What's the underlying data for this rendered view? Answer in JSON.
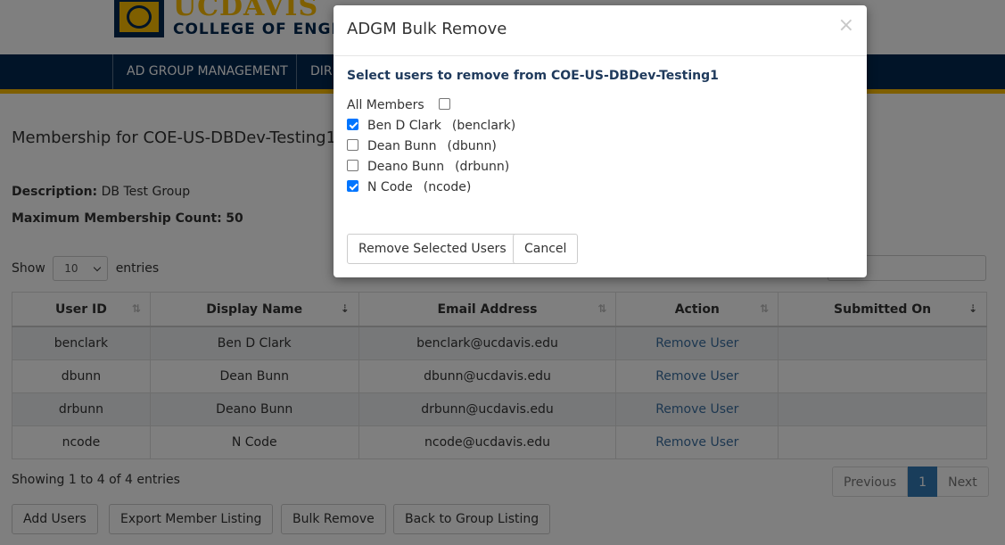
{
  "header": {
    "logo_top": "UCDAVIS",
    "logo_bottom": "COLLEGE OF ENGINEERING",
    "nav": [
      {
        "label": "AD GROUP MANAGEMENT"
      },
      {
        "label": "DIRECTORY"
      }
    ]
  },
  "page": {
    "title": "Membership for COE-US-DBDev-Testing1",
    "description_label": "Description:",
    "description_value": "DB Test Group",
    "max_label": "Maximum Membership Count:",
    "max_value": "50",
    "show_label": "Show",
    "show_value": "10",
    "entries_label": "entries"
  },
  "table": {
    "columns": [
      {
        "label": "User ID",
        "sort": "unsorted"
      },
      {
        "label": "Display Name",
        "sort": "ascending"
      },
      {
        "label": "Email Address",
        "sort": "unsorted"
      },
      {
        "label": "Action",
        "sort": "unsorted"
      },
      {
        "label": "Submitted On",
        "sort": "descending"
      }
    ],
    "rows": [
      {
        "user_id": "benclark",
        "display_name": "Ben D Clark",
        "email": "benclark@ucdavis.edu",
        "action": "Remove User",
        "submitted": ""
      },
      {
        "user_id": "dbunn",
        "display_name": "Dean Bunn",
        "email": "dbunn@ucdavis.edu",
        "action": "Remove User",
        "submitted": ""
      },
      {
        "user_id": "drbunn",
        "display_name": "Deano Bunn",
        "email": "drbunn@ucdavis.edu",
        "action": "Remove User",
        "submitted": ""
      },
      {
        "user_id": "ncode",
        "display_name": "N Code",
        "email": "ncode@ucdavis.edu",
        "action": "Remove User",
        "submitted": ""
      }
    ]
  },
  "footer": {
    "showing": "Showing 1 to 4 of 4 entries",
    "pager": {
      "previous": "Previous",
      "current": "1",
      "next": "Next"
    },
    "buttons": {
      "add_users": "Add Users",
      "export": "Export Member Listing",
      "bulk_remove": "Bulk Remove",
      "back": "Back to Group Listing"
    }
  },
  "modal": {
    "title": "ADGM Bulk Remove",
    "close": "×",
    "subtitle": "Select users to remove from COE-US-DBDev-Testing1",
    "all_members_label": "All Members",
    "all_members_checked": false,
    "users": [
      {
        "name": "Ben D Clark",
        "id": "(benclark)",
        "checked": true
      },
      {
        "name": "Dean Bunn",
        "id": "(dbunn)",
        "checked": false
      },
      {
        "name": "Deano Bunn",
        "id": "(drbunn)",
        "checked": false
      },
      {
        "name": "N Code",
        "id": "(ncode)",
        "checked": true
      }
    ],
    "remove_button": "Remove Selected Users",
    "cancel_button": "Cancel"
  },
  "colors": {
    "navy": "#022851",
    "gold": "#FFBF00",
    "link": "#3b6fa0",
    "checkbox": "#0075ff"
  }
}
